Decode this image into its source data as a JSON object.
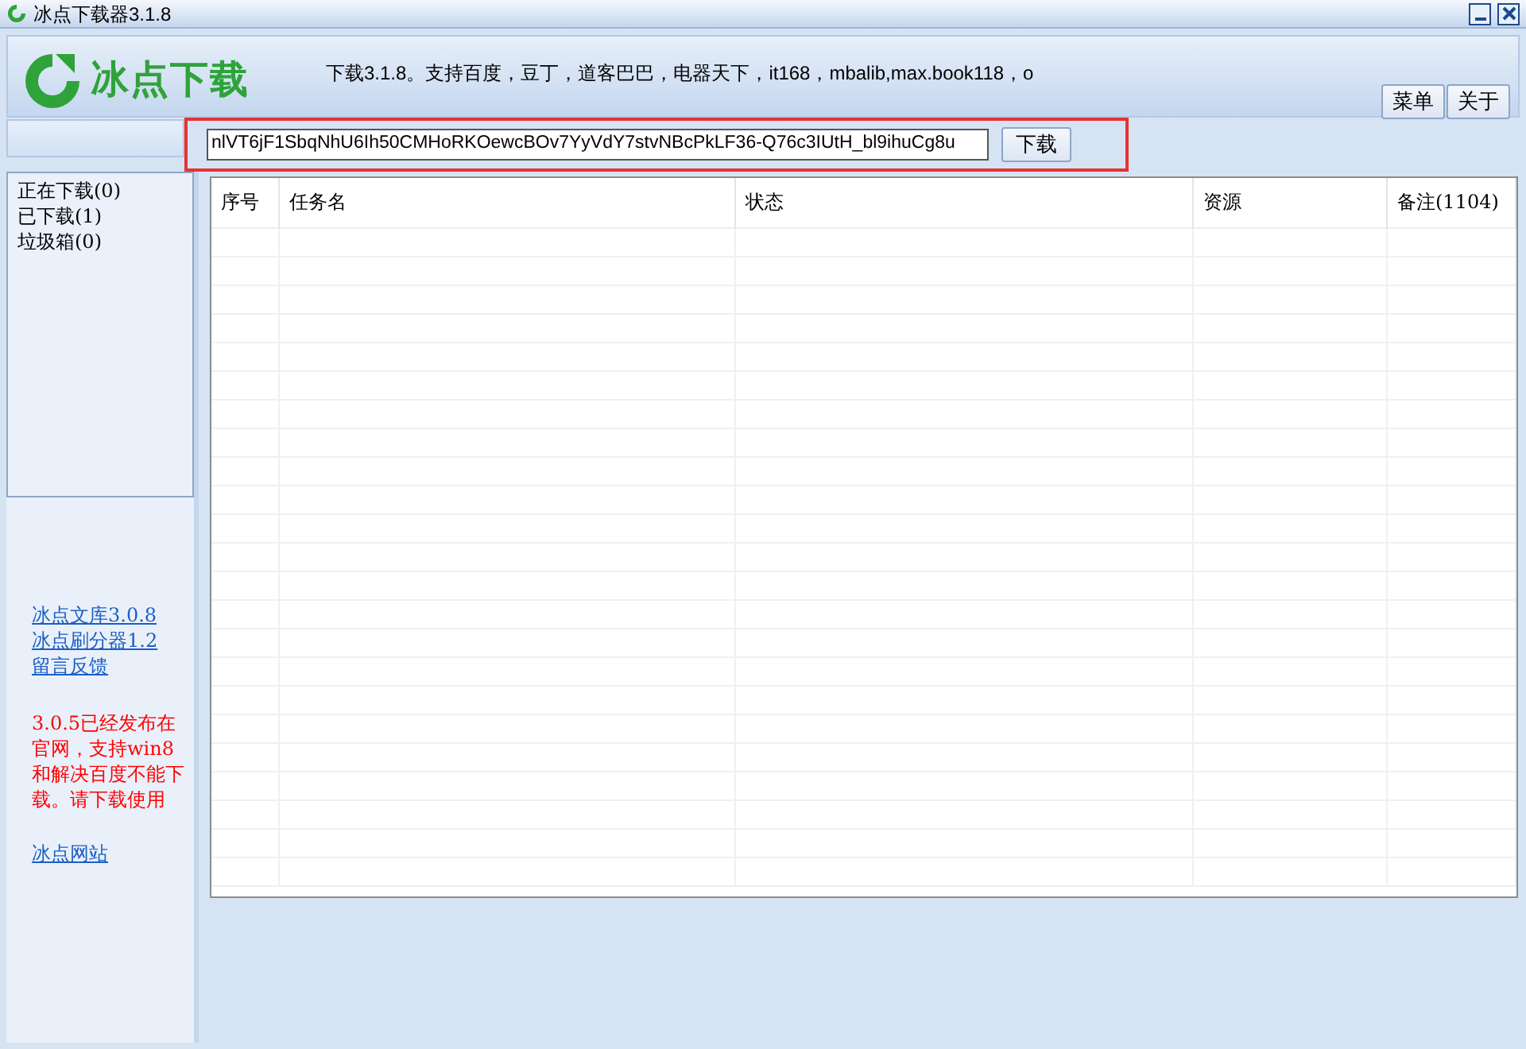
{
  "window": {
    "title": "冰点下载器3.1.8"
  },
  "header": {
    "logo_text": "冰点下载",
    "marquee": "下载3.1.8。支持百度，豆丁，道客巴巴，电器天下，it168，mbalib,max.book118，o",
    "buttons": [
      "菜单",
      "关于"
    ]
  },
  "url_bar": {
    "value": "nlVT6jF1SbqNhU6Ih50CMHoRKOewcBOv7YyVdY7stvNBcPkLF36-Q76c3IUtH_bl9ihuCg8u",
    "button": "下载"
  },
  "sidebar": {
    "items": [
      "正在下载(0)",
      "已下载(1)",
      "垃圾箱(0)"
    ],
    "links": [
      "冰点文库3.0.8",
      "冰点刷分器1.2",
      "留言反馈"
    ],
    "notice": "3.0.5已经发布在官网，支持win8和解决百度不能下载。请下载使用",
    "site_link": "冰点网站"
  },
  "table": {
    "columns": [
      "序号",
      "任务名",
      "状态",
      "资源",
      "备注(1104)"
    ]
  }
}
